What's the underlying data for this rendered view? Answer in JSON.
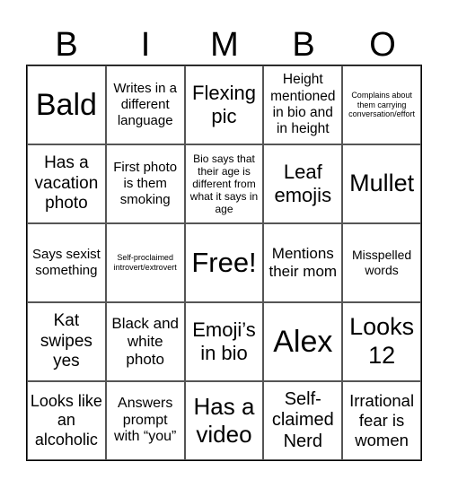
{
  "header": [
    "B",
    "I",
    "M",
    "B",
    "O"
  ],
  "cells": [
    "Bald",
    "Writes in a different language",
    "Flexing pic",
    "Height mentioned in bio and in height",
    "Complains about them carrying conversation/effort",
    "Has a vacation photo",
    "First photo is them smoking",
    "Bio says that their age is different from what it says in age",
    "Leaf emojis",
    "Mullet",
    "Says sexist something",
    "Self-proclaimed introvert/extrovert",
    "Free!",
    "Mentions their mom",
    "Misspelled words",
    "Kat swipes yes",
    "Black and white photo",
    "Emoji’s in bio",
    "Alex",
    "Looks 12",
    "Looks like an alcoholic",
    "Answers prompt with “you”",
    "Has a video",
    "Self-claimed Nerd",
    "Irrational fear is women"
  ]
}
